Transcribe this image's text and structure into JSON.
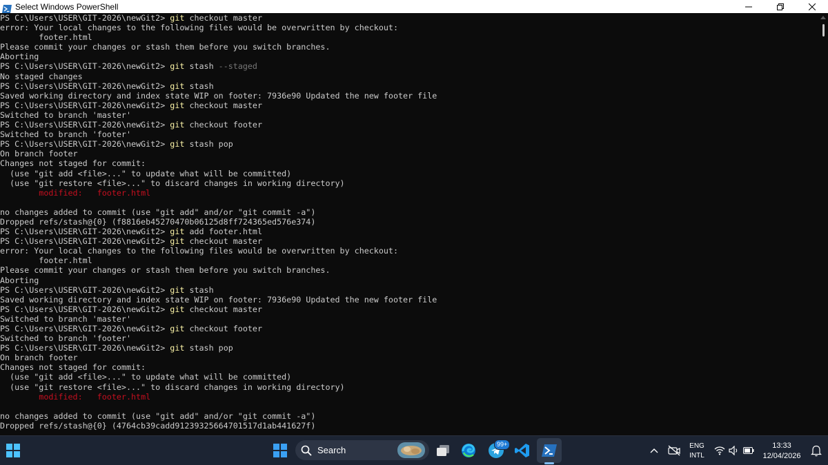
{
  "window": {
    "title": "Select Windows PowerShell",
    "minimize_label": "—",
    "maximize_label": "❐",
    "close_label": "✕"
  },
  "terminal": {
    "lines": [
      {
        "segments": [
          {
            "t": "prompt",
            "v": "PS C:\\Users\\USER\\GIT-2026\\newGit2> "
          },
          {
            "t": "cmd",
            "v": "git"
          },
          {
            "t": "arg",
            "v": " checkout master"
          }
        ]
      },
      {
        "segments": [
          {
            "t": "out",
            "v": "error: Your local changes to the following files would be overwritten by checkout:"
          }
        ]
      },
      {
        "segments": [
          {
            "t": "out",
            "v": "        footer.html"
          }
        ]
      },
      {
        "segments": [
          {
            "t": "out",
            "v": "Please commit your changes or stash them before you switch branches."
          }
        ]
      },
      {
        "segments": [
          {
            "t": "out",
            "v": "Aborting"
          }
        ]
      },
      {
        "segments": [
          {
            "t": "prompt",
            "v": "PS C:\\Users\\USER\\GIT-2026\\newGit2> "
          },
          {
            "t": "cmd",
            "v": "git"
          },
          {
            "t": "arg",
            "v": " stash "
          },
          {
            "t": "flag",
            "v": "--staged"
          }
        ]
      },
      {
        "segments": [
          {
            "t": "out",
            "v": "No staged changes"
          }
        ]
      },
      {
        "segments": [
          {
            "t": "prompt",
            "v": "PS C:\\Users\\USER\\GIT-2026\\newGit2> "
          },
          {
            "t": "cmd",
            "v": "git"
          },
          {
            "t": "arg",
            "v": " stash"
          }
        ]
      },
      {
        "segments": [
          {
            "t": "out",
            "v": "Saved working directory and index state WIP on footer: 7936e90 Updated the new footer file"
          }
        ]
      },
      {
        "segments": [
          {
            "t": "prompt",
            "v": "PS C:\\Users\\USER\\GIT-2026\\newGit2> "
          },
          {
            "t": "cmd",
            "v": "git"
          },
          {
            "t": "arg",
            "v": " checkout master"
          }
        ]
      },
      {
        "segments": [
          {
            "t": "out",
            "v": "Switched to branch 'master'"
          }
        ]
      },
      {
        "segments": [
          {
            "t": "prompt",
            "v": "PS C:\\Users\\USER\\GIT-2026\\newGit2> "
          },
          {
            "t": "cmd",
            "v": "git"
          },
          {
            "t": "arg",
            "v": " checkout footer"
          }
        ]
      },
      {
        "segments": [
          {
            "t": "out",
            "v": "Switched to branch 'footer'"
          }
        ]
      },
      {
        "segments": [
          {
            "t": "prompt",
            "v": "PS C:\\Users\\USER\\GIT-2026\\newGit2> "
          },
          {
            "t": "cmd",
            "v": "git"
          },
          {
            "t": "arg",
            "v": " stash pop"
          }
        ]
      },
      {
        "segments": [
          {
            "t": "out",
            "v": "On branch footer"
          }
        ]
      },
      {
        "segments": [
          {
            "t": "out",
            "v": "Changes not staged for commit:"
          }
        ]
      },
      {
        "segments": [
          {
            "t": "out",
            "v": "  (use \"git add <file>...\" to update what will be committed)"
          }
        ]
      },
      {
        "segments": [
          {
            "t": "out",
            "v": "  (use \"git restore <file>...\" to discard changes in working directory)"
          }
        ]
      },
      {
        "segments": [
          {
            "t": "out",
            "v": "        "
          },
          {
            "t": "mod",
            "v": "modified:   footer.html"
          }
        ]
      },
      {
        "segments": [
          {
            "t": "out",
            "v": ""
          }
        ]
      },
      {
        "segments": [
          {
            "t": "out",
            "v": "no changes added to commit (use \"git add\" and/or \"git commit -a\")"
          }
        ]
      },
      {
        "segments": [
          {
            "t": "out",
            "v": "Dropped refs/stash@{0} (f8816eb45270470b06125d8ff724365ed576e374)"
          }
        ]
      },
      {
        "segments": [
          {
            "t": "prompt",
            "v": "PS C:\\Users\\USER\\GIT-2026\\newGit2> "
          },
          {
            "t": "cmd",
            "v": "git"
          },
          {
            "t": "arg",
            "v": " add footer.html"
          }
        ]
      },
      {
        "segments": [
          {
            "t": "prompt",
            "v": "PS C:\\Users\\USER\\GIT-2026\\newGit2> "
          },
          {
            "t": "cmd",
            "v": "git"
          },
          {
            "t": "arg",
            "v": " checkout master"
          }
        ]
      },
      {
        "segments": [
          {
            "t": "out",
            "v": "error: Your local changes to the following files would be overwritten by checkout:"
          }
        ]
      },
      {
        "segments": [
          {
            "t": "out",
            "v": "        footer.html"
          }
        ]
      },
      {
        "segments": [
          {
            "t": "out",
            "v": "Please commit your changes or stash them before you switch branches."
          }
        ]
      },
      {
        "segments": [
          {
            "t": "out",
            "v": "Aborting"
          }
        ]
      },
      {
        "segments": [
          {
            "t": "prompt",
            "v": "PS C:\\Users\\USER\\GIT-2026\\newGit2> "
          },
          {
            "t": "cmd",
            "v": "git"
          },
          {
            "t": "arg",
            "v": " stash"
          }
        ]
      },
      {
        "segments": [
          {
            "t": "out",
            "v": "Saved working directory and index state WIP on footer: 7936e90 Updated the new footer file"
          }
        ]
      },
      {
        "segments": [
          {
            "t": "prompt",
            "v": "PS C:\\Users\\USER\\GIT-2026\\newGit2> "
          },
          {
            "t": "cmd",
            "v": "git"
          },
          {
            "t": "arg",
            "v": " checkout master"
          }
        ]
      },
      {
        "segments": [
          {
            "t": "out",
            "v": "Switched to branch 'master'"
          }
        ]
      },
      {
        "segments": [
          {
            "t": "prompt",
            "v": "PS C:\\Users\\USER\\GIT-2026\\newGit2> "
          },
          {
            "t": "cmd",
            "v": "git"
          },
          {
            "t": "arg",
            "v": " checkout footer"
          }
        ]
      },
      {
        "segments": [
          {
            "t": "out",
            "v": "Switched to branch 'footer'"
          }
        ]
      },
      {
        "segments": [
          {
            "t": "prompt",
            "v": "PS C:\\Users\\USER\\GIT-2026\\newGit2> "
          },
          {
            "t": "cmd",
            "v": "git"
          },
          {
            "t": "arg",
            "v": " stash pop"
          }
        ]
      },
      {
        "segments": [
          {
            "t": "out",
            "v": "On branch footer"
          }
        ]
      },
      {
        "segments": [
          {
            "t": "out",
            "v": "Changes not staged for commit:"
          }
        ]
      },
      {
        "segments": [
          {
            "t": "out",
            "v": "  (use \"git add <file>...\" to update what will be committed)"
          }
        ]
      },
      {
        "segments": [
          {
            "t": "out",
            "v": "  (use \"git restore <file>...\" to discard changes in working directory)"
          }
        ]
      },
      {
        "segments": [
          {
            "t": "out",
            "v": "        "
          },
          {
            "t": "mod",
            "v": "modified:   footer.html"
          }
        ]
      },
      {
        "segments": [
          {
            "t": "out",
            "v": ""
          }
        ]
      },
      {
        "segments": [
          {
            "t": "out",
            "v": "no changes added to commit (use \"git add\" and/or \"git commit -a\")"
          }
        ]
      },
      {
        "segments": [
          {
            "t": "out",
            "v": "Dropped refs/stash@{0} (4764cb39cadd91239325664701517d1ab441627f)"
          }
        ]
      }
    ]
  },
  "taskbar": {
    "search_label": "Search",
    "notification_badge": "99+",
    "language": "ENG",
    "keyboard_layout": "INTL",
    "time": "13:33",
    "date": "12/04/2026",
    "icons": [
      "windows-start-icon",
      "search-icon",
      "task-view-icon",
      "edge-icon",
      "telegram-icon",
      "vscode-icon",
      "powershell-icon"
    ]
  },
  "colors": {
    "terminal_bg": "#0c0c0c",
    "terminal_fg": "#cccccc",
    "command": "#f9f1a5",
    "flag": "#767676",
    "modified": "#c50f1f",
    "taskbar_bg": "#1c2433"
  }
}
